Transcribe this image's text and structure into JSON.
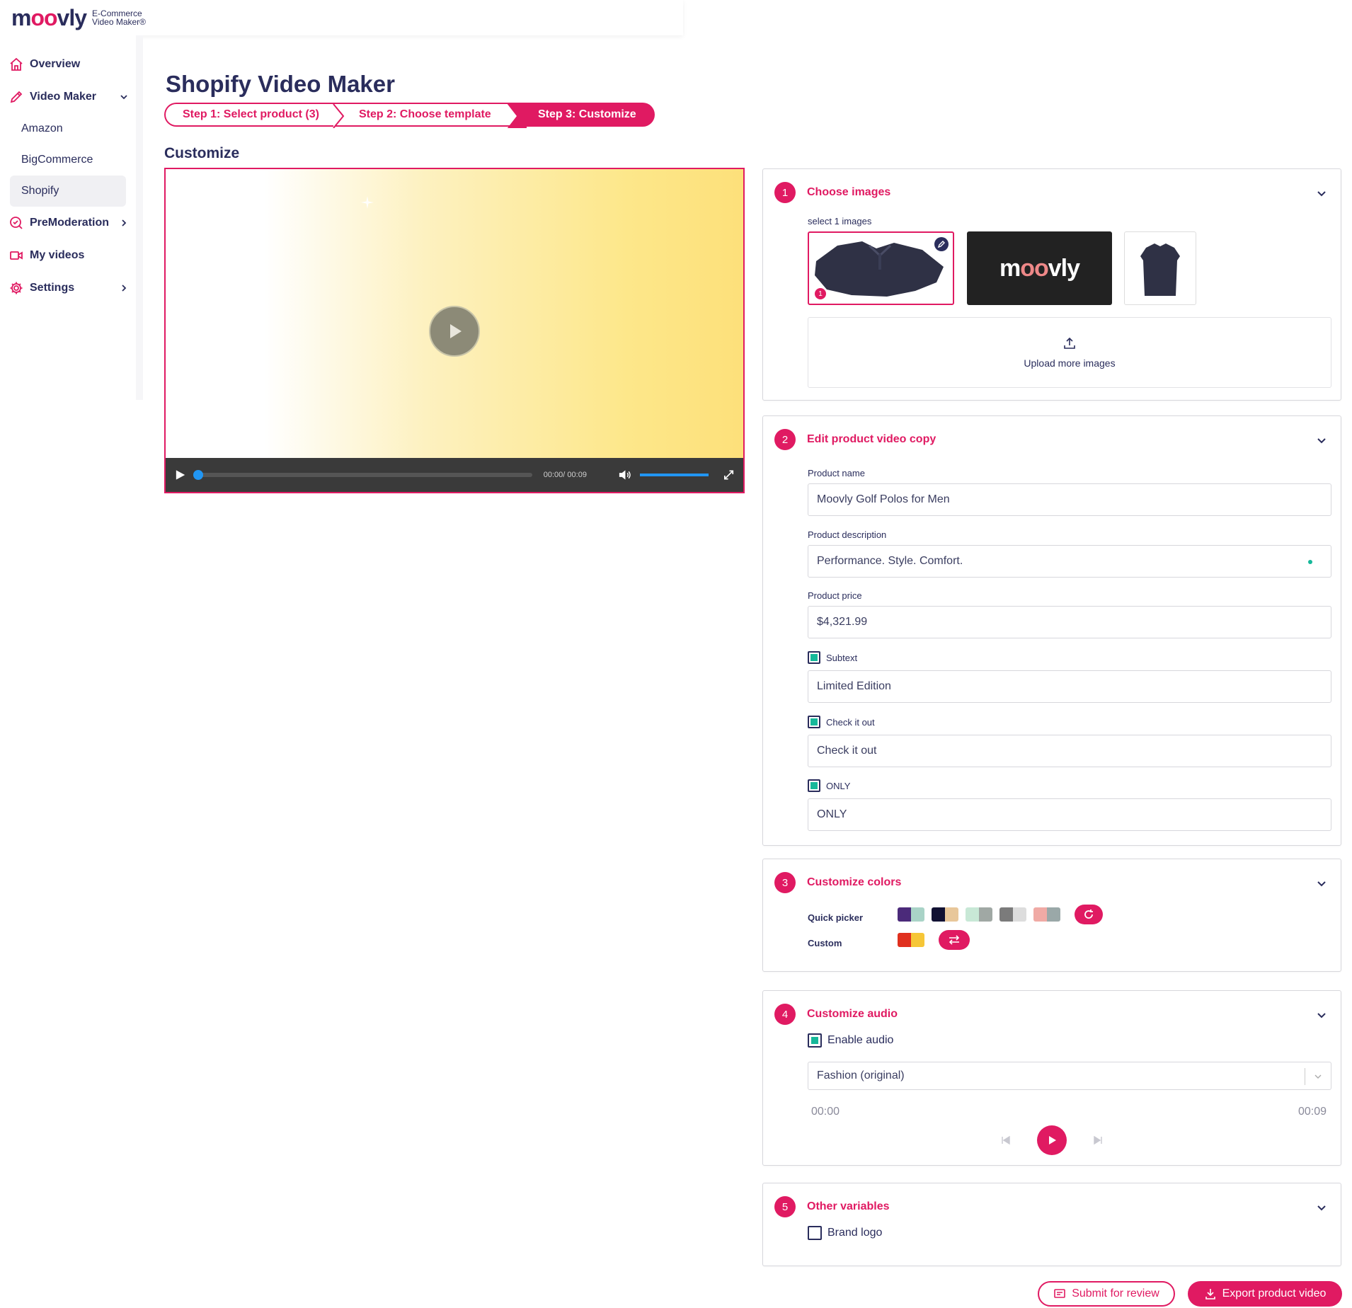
{
  "app": {
    "logo_word_1": "m",
    "logo_word_o1": "o",
    "logo_word_o2": "o",
    "logo_word_2": "vly",
    "logo_sub_1": "E-Commerce",
    "logo_sub_2": "Video Maker®"
  },
  "sidebar": {
    "items": [
      {
        "label": "Overview",
        "icon": "home-icon"
      },
      {
        "label": "Video Maker",
        "icon": "pencil-icon"
      },
      {
        "label": "PreModeration",
        "icon": "search-check-icon"
      },
      {
        "label": "My videos",
        "icon": "video-camera-icon"
      },
      {
        "label": "Settings",
        "icon": "gear-icon"
      }
    ],
    "sub_items": [
      "Amazon",
      "BigCommerce",
      "Shopify"
    ],
    "active_sub": "Shopify"
  },
  "page": {
    "title": "Shopify Video Maker",
    "steps": [
      "Step 1:  Select product (3)",
      "Step 2:  Choose template",
      "Step 3:  Customize"
    ],
    "section_title": "Customize"
  },
  "video": {
    "time": "00:00/ 00:09"
  },
  "panels": {
    "images": {
      "number": "1",
      "title": "Choose images",
      "select_label": "select 1 images",
      "thumb_badge": "1",
      "thumb_2_word_1": "m",
      "thumb_2_word_o1": "o",
      "thumb_2_word_o2": "o",
      "thumb_2_word_2": "vly",
      "upload_label": "Upload more images"
    },
    "copy": {
      "number": "2",
      "title": "Edit product video copy",
      "product_name_label": "Product name",
      "product_name": "Moovly Golf Polos for Men",
      "product_description_label": "Product description",
      "product_description": "Performance. Style. Comfort.",
      "product_price_label": "Product price",
      "product_price": "$4,321.99",
      "subtext_label": "Subtext",
      "subtext": "Limited Edition",
      "checkitout_label": "Check it out",
      "checkitout": "Check it out",
      "only_label": "ONLY",
      "only": "ONLY"
    },
    "colors": {
      "number": "3",
      "title": "Customize colors",
      "quick_label": "Quick picker",
      "custom_label": "Custom",
      "quick_swatches": [
        [
          "#4b2a7a",
          "#a9d3c7"
        ],
        [
          "#111133",
          "#e8c79a"
        ],
        [
          "#c8e8d6",
          "#a0a8a4"
        ],
        [
          "#7b7b7b",
          "#dddddd"
        ],
        [
          "#f0aaa5",
          "#9aa8a8"
        ]
      ],
      "custom_swatch": [
        "#e0301e",
        "#f6c637"
      ]
    },
    "audio": {
      "number": "4",
      "title": "Customize audio",
      "enable_label": "Enable audio",
      "track": "Fashion (original)",
      "time_start": "00:00",
      "time_end": "00:09"
    },
    "other": {
      "number": "5",
      "title": "Other variables",
      "brand_logo_label": "Brand logo"
    }
  },
  "actions": {
    "review": "Submit for review",
    "export": "Export product video"
  },
  "colors": {
    "accent": "#e01a62",
    "navy": "#2a2d5c",
    "check": "#16b89a"
  }
}
